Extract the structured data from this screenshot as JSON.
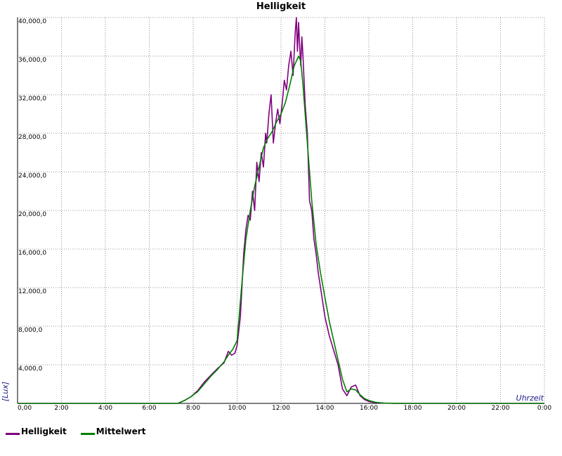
{
  "chart_data": {
    "type": "line",
    "title": "Helligkeit",
    "xlabel": "Uhrzeit",
    "ylabel": "[Lux]",
    "xlim": [
      0,
      24
    ],
    "ylim": [
      0,
      40000
    ],
    "grid": true,
    "legend_position": "bottom-left",
    "x_tick_labels": [
      "0:00",
      "2:00",
      "4:00",
      "6:00",
      "8:00",
      "10:00",
      "12:00",
      "14:00",
      "16:00",
      "18:00",
      "20:00",
      "22:00",
      "0:00"
    ],
    "y_tick_labels": [
      "4,000,0",
      "8,000,0",
      "12,000,0",
      "16,000,0",
      "20,000,0",
      "24,000,0",
      "28,000,0",
      "32,000,0",
      "36,000,0",
      "40,000,0"
    ],
    "y_tick_values": [
      4000,
      8000,
      12000,
      16000,
      20000,
      24000,
      28000,
      32000,
      36000,
      40000
    ],
    "x_origin_label": "0,00",
    "series": [
      {
        "name": "Helligkeit",
        "color": "#800080",
        "x": [
          0,
          7.3,
          7.6,
          7.9,
          8.2,
          8.5,
          8.8,
          9.1,
          9.4,
          9.6,
          9.75,
          9.9,
          10.0,
          10.15,
          10.3,
          10.4,
          10.5,
          10.6,
          10.7,
          10.8,
          10.9,
          11.0,
          11.1,
          11.2,
          11.3,
          11.35,
          11.45,
          11.55,
          11.65,
          11.75,
          11.85,
          11.95,
          12.05,
          12.15,
          12.25,
          12.35,
          12.45,
          12.55,
          12.65,
          12.7,
          12.75,
          12.8,
          12.85,
          12.9,
          12.95,
          13.0,
          13.1,
          13.2,
          13.3,
          13.4,
          13.5,
          13.6,
          13.7,
          13.8,
          13.9,
          14.0,
          14.2,
          14.4,
          14.6,
          14.8,
          15.0,
          15.2,
          15.4,
          15.6,
          15.8,
          16.0,
          16.3,
          16.7,
          17.2,
          17.7,
          18.0,
          24
        ],
        "y": [
          0,
          0,
          300,
          700,
          1300,
          2200,
          2900,
          3600,
          4200,
          5400,
          5000,
          5200,
          6000,
          9000,
          15500,
          18000,
          19500,
          19000,
          22000,
          20000,
          25000,
          23000,
          26000,
          24500,
          28000,
          27000,
          30000,
          32000,
          27000,
          29000,
          30500,
          29000,
          31000,
          33500,
          32500,
          35000,
          36500,
          34000,
          38500,
          40000,
          36500,
          39500,
          37000,
          35000,
          38000,
          36000,
          31000,
          28000,
          21000,
          20000,
          17000,
          15500,
          13500,
          12000,
          10500,
          9000,
          7000,
          5500,
          4000,
          1500,
          800,
          1700,
          1900,
          800,
          400,
          200,
          80,
          20,
          0,
          0,
          0,
          0
        ]
      },
      {
        "name": "Mittelwert",
        "color": "#008000",
        "x": [
          0,
          7.3,
          7.6,
          7.9,
          8.2,
          8.5,
          8.8,
          9.1,
          9.4,
          9.6,
          9.8,
          10.0,
          10.2,
          10.4,
          10.6,
          10.8,
          11.0,
          11.2,
          11.4,
          11.6,
          11.8,
          12.0,
          12.2,
          12.4,
          12.6,
          12.8,
          12.9,
          13.0,
          13.2,
          13.4,
          13.6,
          13.8,
          14.0,
          14.2,
          14.4,
          14.6,
          14.8,
          15.0,
          15.2,
          15.4,
          15.6,
          15.8,
          16.0,
          16.3,
          16.7,
          17.2,
          17.7,
          18.0,
          24
        ],
        "y": [
          0,
          0,
          300,
          700,
          1200,
          2000,
          2800,
          3500,
          4300,
          5000,
          5600,
          6500,
          12000,
          17000,
          20000,
          22500,
          24500,
          26500,
          27500,
          28200,
          29200,
          30000,
          31200,
          33000,
          35000,
          36000,
          35500,
          33000,
          27000,
          21000,
          16500,
          13500,
          11000,
          8500,
          6500,
          4500,
          2500,
          1200,
          1500,
          1400,
          900,
          500,
          300,
          120,
          40,
          10,
          0,
          0,
          0
        ]
      }
    ]
  },
  "legend": {
    "items": [
      {
        "label": "Helligkeit",
        "color": "#800080"
      },
      {
        "label": "Mittelwert",
        "color": "#008000"
      }
    ]
  }
}
